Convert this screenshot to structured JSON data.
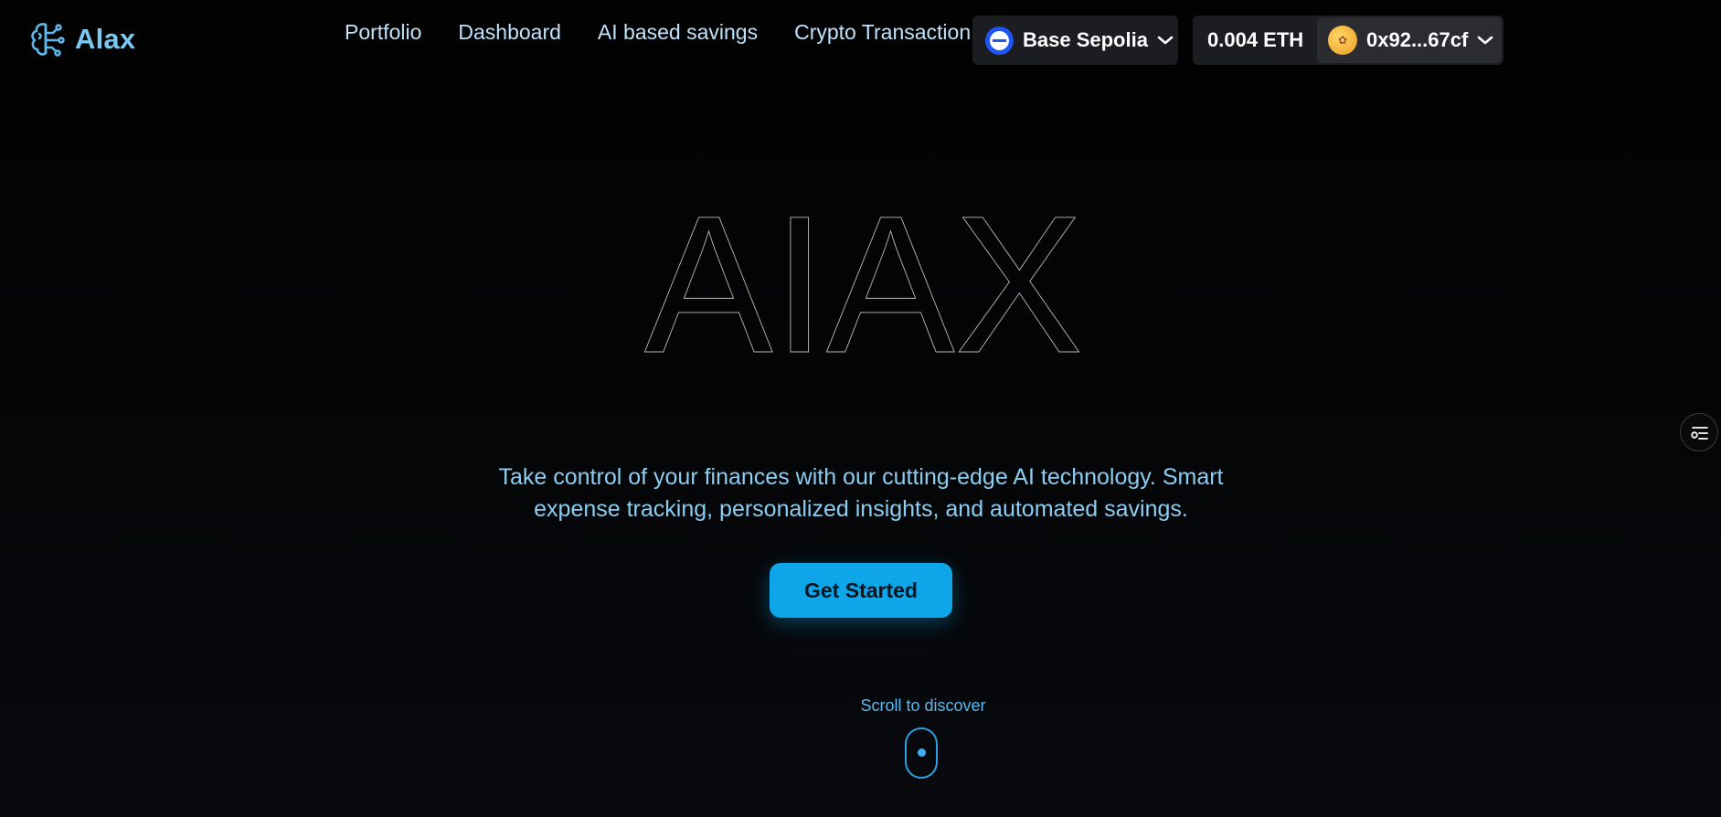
{
  "header": {
    "brand_name": "Alax",
    "nav": [
      {
        "label": "Portfolio"
      },
      {
        "label": "Dashboard"
      },
      {
        "label": "AI based savings"
      },
      {
        "label": "Crypto Transaction"
      }
    ],
    "network": {
      "label": "Base Sepolia",
      "icon": "base-network-icon"
    },
    "balance": "0.004 ETH",
    "account": {
      "address": "0x92...67cf",
      "icon": "avatar"
    }
  },
  "hero": {
    "title": "AIAX",
    "tagline_line1": "Take control of your finances with our cutting-edge AI technology. Smart",
    "tagline_line2": "expense tracking, personalized insights, and automated savings.",
    "cta_label": "Get Started",
    "scroll_label": "Scroll to discover"
  },
  "colors": {
    "background": "#030303",
    "accent": "#0ea5e9",
    "brand": "#7cc8f0",
    "nav_text": "#bfe3fb"
  }
}
